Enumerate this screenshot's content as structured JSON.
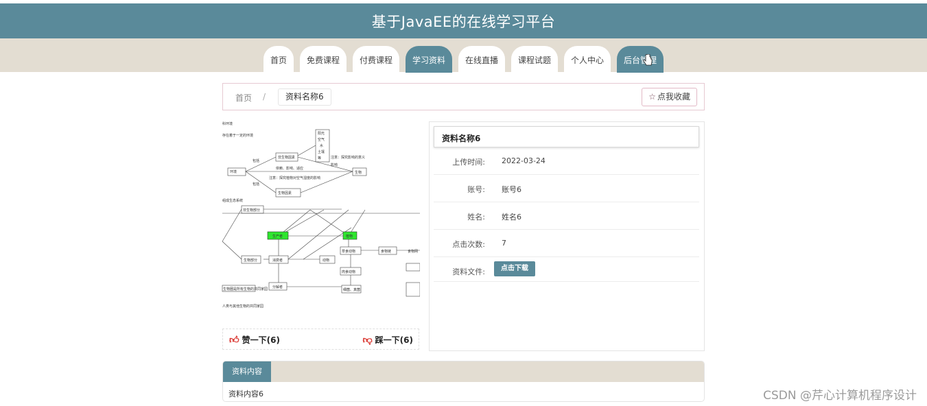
{
  "header": {
    "title": "基于JavaEE的在线学习平台"
  },
  "nav": {
    "tabs": [
      {
        "label": "首页",
        "active": false
      },
      {
        "label": "免费课程",
        "active": false
      },
      {
        "label": "付费课程",
        "active": false
      },
      {
        "label": "学习资料",
        "active": true
      },
      {
        "label": "在线直播",
        "active": false
      },
      {
        "label": "课程试题",
        "active": false
      },
      {
        "label": "个人中心",
        "active": false
      },
      {
        "label": "后台管理",
        "active": true
      }
    ]
  },
  "breadcrumb": {
    "home": "首页",
    "separator": "/",
    "current": "资料名称6",
    "favorite_label": "点我收藏",
    "favorite_icon": "star-icon"
  },
  "image": {
    "labels": {
      "t1": "科环境",
      "t2": "存在着于一定的环境",
      "sun": "阳光",
      "air": "空气",
      "water": "水",
      "soil": "土壤",
      "etc": "等",
      "abiotic": "非生物因素",
      "include1": "包括",
      "include2": "包括",
      "note1": "注意：探究影响的意义",
      "env": "环境",
      "affect": "影响",
      "mutual": "依赖、影响、适应",
      "note2": "注意：探究植物对空气湿度的影响",
      "biotic": "生物因素",
      "organism": "生物",
      "eco": "组成生态系统",
      "abiotic_part": "非生物部分",
      "bio_part": "生物部分",
      "producer": "生产者",
      "consumer": "消费者",
      "decomposer": "分解者",
      "plant": "植物",
      "animal": "动物",
      "herbivore": "草食动物",
      "carnivore": "肉食动物",
      "fungi": "细菌、真菌",
      "chain": "食物链",
      "web": "食物网",
      "cap1": "生物圈是所有生物的共同家园",
      "cap2": "人类与其他生物的共同家园"
    }
  },
  "votes": {
    "up_label": "赞一下(6)",
    "down_label": "踩一下(6)",
    "up_icon": "thumbs-up-icon",
    "down_icon": "thumbs-down-icon"
  },
  "info": {
    "title": "资料名称6",
    "rows": [
      {
        "label": "上传时间:",
        "value": "2022-03-24"
      },
      {
        "label": "账号:",
        "value": "账号6"
      },
      {
        "label": "姓名:",
        "value": "姓名6"
      },
      {
        "label": "点击次数:",
        "value": "7"
      },
      {
        "label": "资料文件:",
        "button": "点击下载"
      }
    ]
  },
  "content": {
    "tab": "资料内容",
    "body": "资料内容6"
  },
  "watermark": "CSDN @芹心计算机程序设计"
}
